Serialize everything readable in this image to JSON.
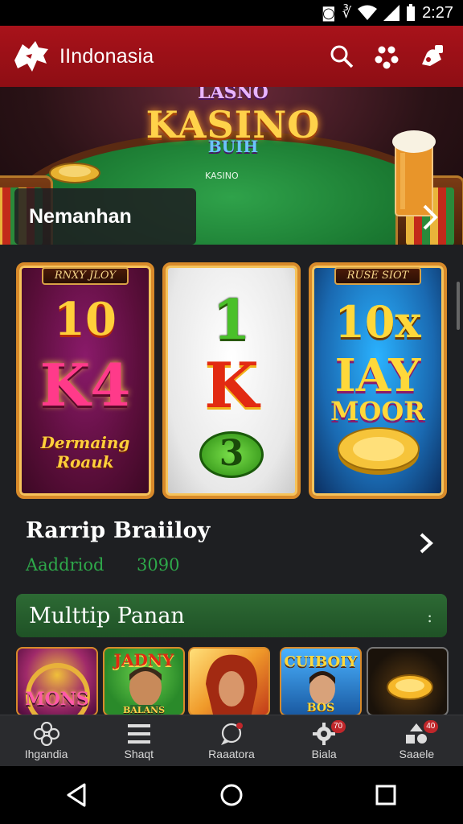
{
  "status_bar": {
    "time": "2:27"
  },
  "header": {
    "title": "IIndonasia",
    "badge_color": "#a8121a"
  },
  "banner": {
    "logo_top": "LASNO",
    "logo_main": "KASINO",
    "logo_bottom": "BUIH",
    "table_label": "KASINO",
    "caption": "Nemanhan"
  },
  "cards": [
    {
      "ribbon": "RNXY JLOY",
      "line1": "10",
      "line2": "K4",
      "line3": "Dermaing",
      "line4": "Roauk"
    },
    {
      "line1": "1",
      "line2": "K",
      "line3": "3"
    },
    {
      "ribbon": "RUSE SIOT",
      "line1": "10x",
      "line2": "IAY",
      "line3": "MOOR"
    }
  ],
  "section": {
    "title": "Rarrip Braiiloy",
    "sub_label": "Aaddriod",
    "sub_value": "3090"
  },
  "multi_bar": {
    "label": "Multtip Panan",
    "arrow": ":"
  },
  "thumbs": [
    {
      "text": "MONS"
    },
    {
      "text": "JADNY",
      "text2": "BALANS"
    },
    {
      "text": ""
    },
    {
      "text": "CUIBOIY",
      "text2": "BOS"
    },
    {
      "text": ""
    }
  ],
  "bottom_nav": [
    {
      "label": "Ihgandia",
      "icon": "clover-icon"
    },
    {
      "label": "Shaqt",
      "icon": "menu-icon"
    },
    {
      "label": "Raaatora",
      "icon": "chat-icon"
    },
    {
      "label": "Biala",
      "icon": "gear-icon",
      "badge": "70"
    },
    {
      "label": "Saaele",
      "icon": "shapes-icon",
      "badge": "40"
    }
  ]
}
